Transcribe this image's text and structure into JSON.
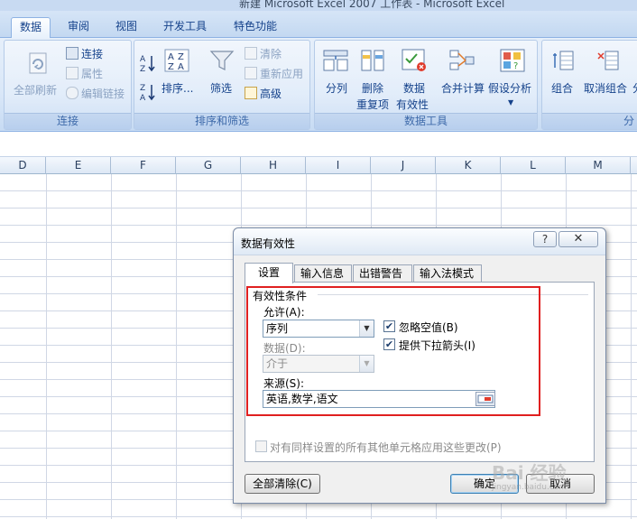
{
  "window": {
    "title": "新建 Microsoft Excel 2007 工作表 - Microsoft Excel"
  },
  "ribbon_tabs": [
    "数据",
    "审阅",
    "视图",
    "开发工具",
    "特色功能"
  ],
  "ribbon": {
    "connections": {
      "label": "连接",
      "refresh_all": "全部刷新",
      "connections": "连接",
      "properties": "属性",
      "edit_links": "编辑链接"
    },
    "sort_filter": {
      "label": "排序和筛选",
      "sort": "排序...",
      "filter": "筛选",
      "clear": "清除",
      "reapply": "重新应用",
      "advanced": "高级"
    },
    "data_tools": {
      "label": "数据工具",
      "text_to_columns": "分列",
      "remove_duplicates_1": "删除",
      "remove_duplicates_2": "重复项",
      "validation_1": "数据",
      "validation_2": "有效性",
      "consolidate": "合并计算",
      "what_if": "假设分析"
    },
    "outline": {
      "label": "分",
      "group": "组合",
      "ungroup": "取消组合",
      "subtotal": "分"
    }
  },
  "columns": [
    "D",
    "E",
    "F",
    "G",
    "H",
    "I",
    "J",
    "K",
    "L",
    "M"
  ],
  "dialog": {
    "title": "数据有效性",
    "help": "?",
    "close": "✕",
    "tabs": [
      "设置",
      "输入信息",
      "出错警告",
      "输入法模式"
    ],
    "section": "有效性条件",
    "allow_label": "允许(A):",
    "allow_value": "序列",
    "ignore_blank": {
      "label": "忽略空值(B)",
      "checked": true
    },
    "in_cell_dropdown": {
      "label": "提供下拉箭头(I)",
      "checked": true
    },
    "data_label": "数据(D):",
    "data_value": "介于",
    "source_label": "来源(S):",
    "source_value": "英语,数学,语文",
    "apply_all": {
      "label": "对有同样设置的所有其他单元格应用这些更改(P)",
      "checked": false
    },
    "clear_all": "全部清除(C)",
    "ok": "确定",
    "cancel": "取消"
  },
  "watermark": {
    "brand": "Bai 经验",
    "url": "jingyan.baidu.com"
  },
  "colors": {
    "accent": "#15428b",
    "highlight_box": "#e02020",
    "ribbon_bg": "#d9e7f8"
  }
}
